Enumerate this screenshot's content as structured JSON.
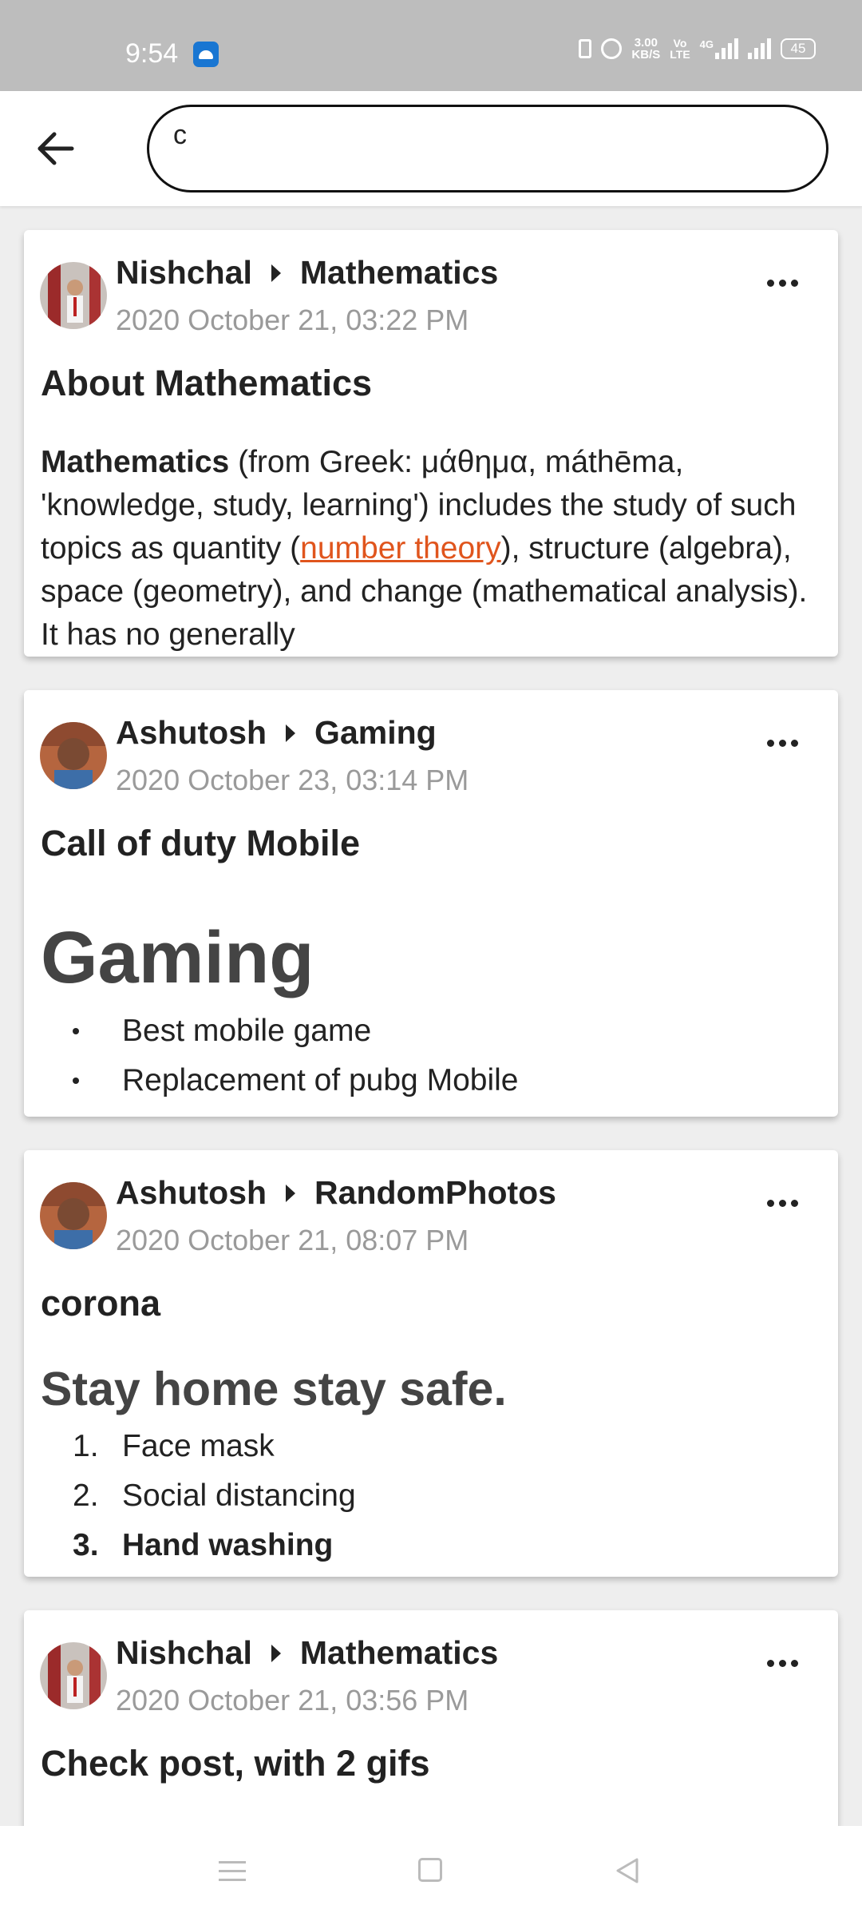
{
  "status_bar": {
    "time": "9:54",
    "speed_value": "3.00",
    "speed_unit": "KB/S",
    "volte_top": "Vo",
    "volte_bottom": "LTE",
    "network": "4G",
    "battery": "45"
  },
  "search": {
    "value": "c",
    "placeholder": ""
  },
  "icons": {
    "back": "arrow-left-icon",
    "more": "more-horizontal-icon",
    "breadcrumb": "caret-right-icon"
  },
  "posts": [
    {
      "author": "Nishchal",
      "community": "Mathematics",
      "date": "2020 October 21, 03:22 PM",
      "title": "About Mathematics",
      "body_bold": "Mathematics",
      "body_text_1": " (from Greek: μάθημα, máthēma, 'knowledge, study, learning') includes the study of such topics as quantity (",
      "body_link": "number theory",
      "body_text_2": "), structure (algebra), space (geometry), and change (mathematical analysis). It has no generally"
    },
    {
      "author": "Ashutosh",
      "community": "Gaming",
      "date": "2020 October 23, 03:14 PM",
      "title": "Call of duty Mobile",
      "heading": "Gaming",
      "items": [
        "Best mobile game",
        "Replacement of pubg Mobile"
      ]
    },
    {
      "author": "Ashutosh",
      "community": "RandomPhotos",
      "date": "2020 October 21, 08:07 PM",
      "title": "corona",
      "heading": "Stay home stay safe.",
      "items": [
        "Face mask",
        "Social distancing",
        "Hand washing"
      ],
      "item_numbers": [
        "1.",
        "2.",
        "3."
      ]
    },
    {
      "author": "Nishchal",
      "community": "Mathematics",
      "date": "2020 October 21, 03:56 PM",
      "title": "Check post, with 2 gifs"
    }
  ],
  "colors": {
    "accent_link": "#e0551d",
    "status_bar_bg": "#bdbdbd",
    "date_text": "#9a9a9a"
  }
}
